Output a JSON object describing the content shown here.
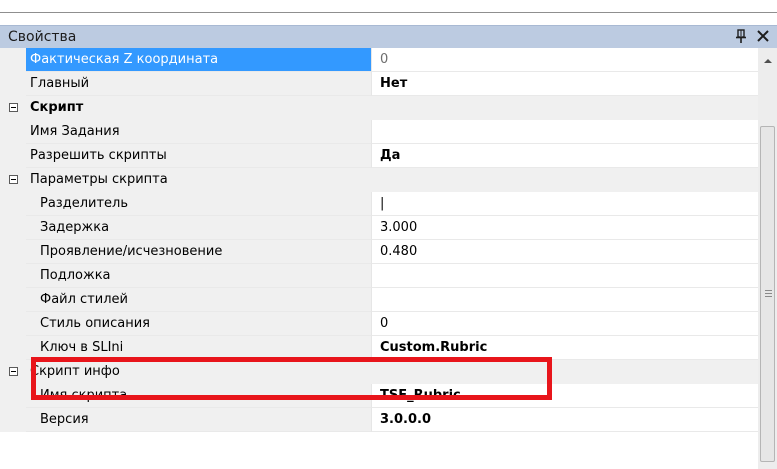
{
  "panel": {
    "title": "Свойства",
    "pin_icon": "pin-icon",
    "close_icon": "close-icon"
  },
  "rows": {
    "z_coord": {
      "name": "Фактическая Z координата",
      "value": "0"
    },
    "main": {
      "name": "Главный",
      "value": "Нет"
    },
    "script_category": {
      "label": "Скрипт"
    },
    "task_name": {
      "name": "Имя Задания",
      "value": ""
    },
    "allow_scripts": {
      "name": "Разрешить скрипты",
      "value": "Да"
    },
    "script_params_category": {
      "label": "Параметры скрипта"
    },
    "separator": {
      "name": "Разделитель",
      "value": "|"
    },
    "delay": {
      "name": "Задержка",
      "value": "3.000"
    },
    "fade": {
      "name": "Проявление/исчезновение",
      "value": "0.480"
    },
    "background": {
      "name": "Подложка",
      "value": ""
    },
    "style_file": {
      "name": "Файл стилей",
      "value": ""
    },
    "desc_style": {
      "name": "Стиль описания",
      "value": "0"
    },
    "slini_key": {
      "name": "Ключ в SLIni",
      "value": "Custom.Rubric"
    },
    "script_info_category": {
      "label": "Скрипт инфо"
    },
    "script_name": {
      "name": "Имя скрипта",
      "value": "TSF_Rubric"
    },
    "version": {
      "name": "Версия",
      "value": "3.0.0.0"
    }
  },
  "colors": {
    "selection": "#3399ff",
    "highlight_box": "#e8151b",
    "title_bar": "#bccbe1",
    "gutter": "#f0f0f0"
  }
}
